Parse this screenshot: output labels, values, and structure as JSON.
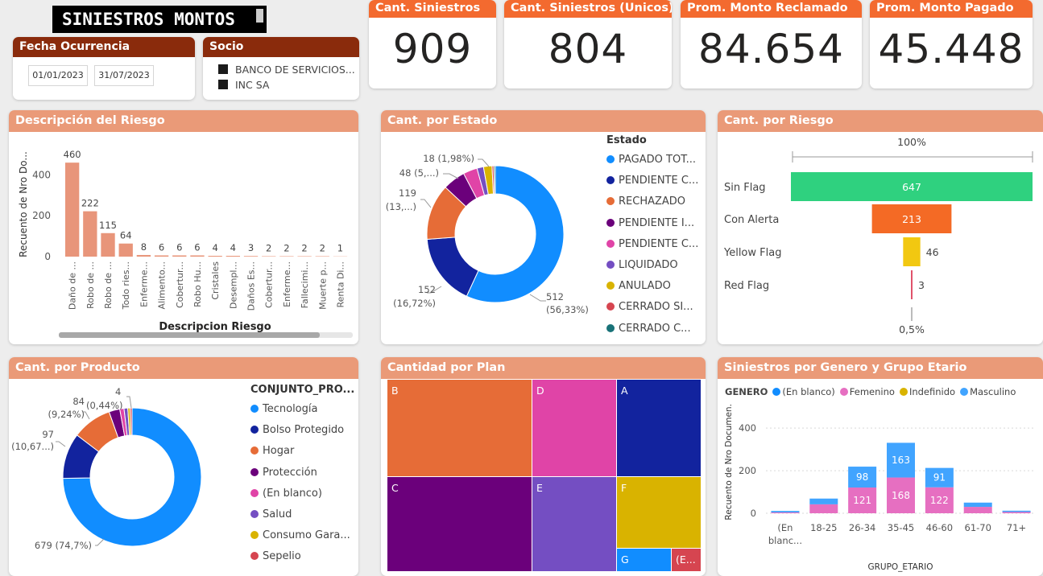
{
  "title": "SINIESTROS MONTOS",
  "colors": {
    "panel_header": "#ea9a78",
    "filter_header": "#8a2b0c",
    "kpi_header": "#f36a2f",
    "bar_salmon": "#e8957a"
  },
  "filters": {
    "fecha": {
      "label": "Fecha Ocurrencia",
      "from": "01/01/2023",
      "to": "31/07/2023"
    },
    "socio": {
      "label": "Socio",
      "items": [
        "BANCO DE SERVICIOS...",
        "INC SA"
      ]
    }
  },
  "kpis": [
    {
      "label": "Cant. Siniestros",
      "value": "909"
    },
    {
      "label": "Cant. Siniestros (Unicos)",
      "value": "804"
    },
    {
      "label": "Prom. Monto Reclamado",
      "value": "84.654"
    },
    {
      "label": "Prom. Monto Pagado",
      "value": "45.448"
    }
  ],
  "panels": {
    "riesgo_desc": "Descripción del Riesgo",
    "estado": "Cant. por Estado",
    "riesgo": "Cant. por Riesgo",
    "producto": "Cant. por Producto",
    "plan": "Cantidad por Plan",
    "genero": "Siniestros por Genero y Grupo Etario"
  },
  "chart_data": [
    {
      "id": "descripcion_riesgo",
      "type": "bar",
      "xlabel": "Descripcion Riesgo",
      "ylabel": "Recuento de Nro Do...",
      "ylim": [
        0,
        500
      ],
      "yticks": [
        0,
        200,
        400
      ],
      "categories": [
        "Daño de ...",
        "Robo de ...",
        "Robo de ...",
        "Todo ries...",
        "Enferme...",
        "Alimento...",
        "Cobertur...",
        "Robo Hu...",
        "Cristales",
        "Desempl...",
        "Daños Es...",
        "Cobertur...",
        "Enferme...",
        "Fallecimi...",
        "Muerte p...",
        "Renta Di..."
      ],
      "values": [
        460,
        222,
        115,
        64,
        8,
        6,
        6,
        6,
        4,
        4,
        3,
        2,
        2,
        2,
        2,
        1
      ],
      "color": "#e8957a"
    },
    {
      "id": "estado",
      "type": "pie",
      "legend_title": "Estado",
      "slices": [
        {
          "name": "PAGADO TOT...",
          "value": 512,
          "label": "512",
          "pct": "(56,33%)",
          "color": "#118dff"
        },
        {
          "name": "PENDIENTE C...",
          "value": 152,
          "label": "152",
          "pct": "(16,72%)",
          "color": "#12239e"
        },
        {
          "name": "RECHAZADO",
          "value": 119,
          "label": "119",
          "pct": "(13,...)",
          "color": "#e66c37"
        },
        {
          "name": "PENDIENTE I...",
          "value": 48,
          "label": "48 (5,...)",
          "pct": "",
          "color": "#6b007b"
        },
        {
          "name": "PENDIENTE C...",
          "value": 30,
          "label": "",
          "pct": "",
          "color": "#e044a7"
        },
        {
          "name": "LIQUIDADO",
          "value": 14,
          "label": "",
          "pct": "",
          "color": "#744ec2"
        },
        {
          "name": "ANULADO",
          "value": 18,
          "label": "18 (1,98%)",
          "pct": "",
          "color": "#d9b300"
        },
        {
          "name": "CERRADO SI...",
          "value": 4,
          "label": "",
          "pct": "",
          "color": "#d64550"
        },
        {
          "name": "CERRADO C...",
          "value": 3,
          "label": "",
          "pct": "",
          "color": "#197278"
        }
      ]
    },
    {
      "id": "riesgo",
      "type": "bar",
      "subtype": "funnel",
      "top_label": "100%",
      "bottom_label": "0,5%",
      "categories": [
        "Sin Flag",
        "Con Alerta",
        "Yellow Flag",
        "Red Flag"
      ],
      "values": [
        647,
        213,
        46,
        3
      ],
      "colors": [
        "#2fd17f",
        "#f46a25",
        "#f2c811",
        "#e0526b"
      ]
    },
    {
      "id": "producto",
      "type": "pie",
      "legend_title": "CONJUNTO_PRO...",
      "slices": [
        {
          "name": "Tecnología",
          "value": 679,
          "label": "679 (74,7%)",
          "color": "#118dff"
        },
        {
          "name": "Bolso Protegido",
          "value": 97,
          "label": "97",
          "pct": "(10,67...)",
          "color": "#12239e"
        },
        {
          "name": "Hogar",
          "value": 84,
          "label": "84",
          "pct": "(9,24%)",
          "color": "#e66c37"
        },
        {
          "name": "Protección",
          "value": 23,
          "label": "",
          "color": "#6b007b"
        },
        {
          "name": "(En blanco)",
          "value": 9,
          "label": "",
          "color": "#e044a7"
        },
        {
          "name": "Salud",
          "value": 8,
          "label": "",
          "color": "#744ec2"
        },
        {
          "name": "Consumo Gara...",
          "value": 5,
          "label": "",
          "color": "#d9b300"
        },
        {
          "name": "Sepelio",
          "value": 4,
          "label": "4",
          "pct": "(0,44%)",
          "color": "#d64550"
        }
      ]
    },
    {
      "id": "plan",
      "type": "heatmap",
      "subtype": "treemap",
      "items": [
        {
          "name": "B",
          "color": "#e66c37"
        },
        {
          "name": "D",
          "color": "#e044a7"
        },
        {
          "name": "A",
          "color": "#12239e"
        },
        {
          "name": "C",
          "color": "#6b007b"
        },
        {
          "name": "E",
          "color": "#744ec2"
        },
        {
          "name": "F",
          "color": "#d9b300"
        },
        {
          "name": "G",
          "color": "#118dff"
        },
        {
          "name": "(E...",
          "color": "#d64550"
        }
      ]
    },
    {
      "id": "genero_grupo",
      "type": "bar",
      "stacked": true,
      "legend_title": "GENERO",
      "xlabel": "GRUPO_ETARIO",
      "ylabel": "Recuento de Nro Documen...",
      "ylim": [
        0,
        480
      ],
      "yticks": [
        0,
        200,
        400
      ],
      "categories": [
        "(En blanc...",
        "18-25",
        "26-34",
        "35-45",
        "46-60",
        "61-70",
        "71+"
      ],
      "category_lines": [
        [
          "(En",
          "blanc..."
        ],
        [
          "18-25"
        ],
        [
          "26-34"
        ],
        [
          "35-45"
        ],
        [
          "46-60"
        ],
        [
          "61-70"
        ],
        [
          "71+"
        ]
      ],
      "series": [
        {
          "name": "(En blanco)",
          "color": "#118dff",
          "values": [
            0,
            0,
            0,
            0,
            0,
            0,
            0
          ]
        },
        {
          "name": "Femenino",
          "color": "#e66fc1",
          "values": [
            4,
            42,
            121,
            168,
            122,
            30,
            6
          ],
          "labels": [
            "",
            "",
            "121",
            "168",
            "122",
            "",
            ""
          ]
        },
        {
          "name": "Indefinido",
          "color": "#d9b300",
          "values": [
            0,
            0,
            0,
            0,
            0,
            0,
            0
          ]
        },
        {
          "name": "Masculino",
          "color": "#41a4ff",
          "values": [
            7,
            27,
            98,
            163,
            91,
            20,
            6
          ],
          "labels": [
            "",
            "",
            "98",
            "163",
            "91",
            "",
            ""
          ]
        }
      ]
    }
  ]
}
